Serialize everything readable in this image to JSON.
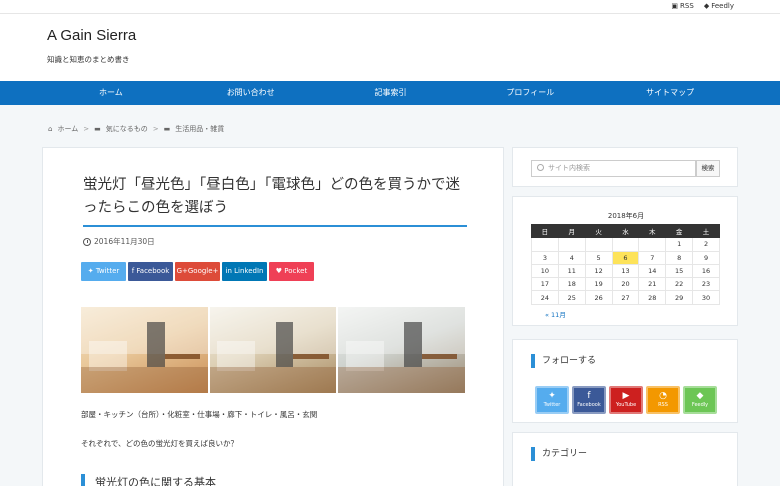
{
  "topbar": {
    "rss": "RSS",
    "feedly": "Feedly"
  },
  "header": {
    "title": "A Gain Sierra",
    "description": "知識と知恵のまとめ書き"
  },
  "nav": {
    "items": [
      "ホーム",
      "お問い合わせ",
      "記事索引",
      "プロフィール",
      "サイトマップ"
    ]
  },
  "breadcrumb": {
    "home": "ホーム",
    "cat1": "気になるもの",
    "cat2": "生活用品・雑貨"
  },
  "article": {
    "title": "蛍光灯「昼光色」「昼白色」「電球色」どの色を買うかで迷ったらこの色を選ぼう",
    "date": "2016年11月30日",
    "share": {
      "twitter": "Twitter",
      "facebook": "Facebook",
      "googleplus": "G+Google+",
      "linkedin": "LinkedIn",
      "pocket": "Pocket"
    },
    "text1": "部屋・キッチン（台所）・化粧室・仕事場・廊下・トイレ・風呂・玄関",
    "text2": "それぞれで、どの色の蛍光灯を買えば良いか？",
    "heading": "蛍光灯の色に関する基本"
  },
  "sidebar": {
    "search": {
      "placeholder": "サイト内検索",
      "button": "検索"
    },
    "calendar": {
      "title": "2018年6月",
      "weekdays": [
        "日",
        "月",
        "火",
        "水",
        "木",
        "金",
        "土"
      ],
      "rows": [
        [
          "",
          "",
          "",
          "",
          "",
          "1",
          "2"
        ],
        [
          "3",
          "4",
          "5",
          "6",
          "7",
          "8",
          "9"
        ],
        [
          "10",
          "11",
          "12",
          "13",
          "14",
          "15",
          "16"
        ],
        [
          "17",
          "18",
          "19",
          "20",
          "21",
          "22",
          "23"
        ],
        [
          "24",
          "25",
          "26",
          "27",
          "28",
          "29",
          "30"
        ]
      ],
      "today": "6",
      "prev": "« 11月"
    },
    "follow": {
      "heading": "フォローする",
      "buttons": [
        "Twitter",
        "Facebook",
        "YouTube",
        "RSS",
        "Feedly"
      ]
    },
    "category": {
      "heading": "カテゴリー"
    }
  },
  "colors": {
    "nav": "#0e70c0",
    "accent": "#2b8fd6",
    "today": "#fde35a"
  }
}
